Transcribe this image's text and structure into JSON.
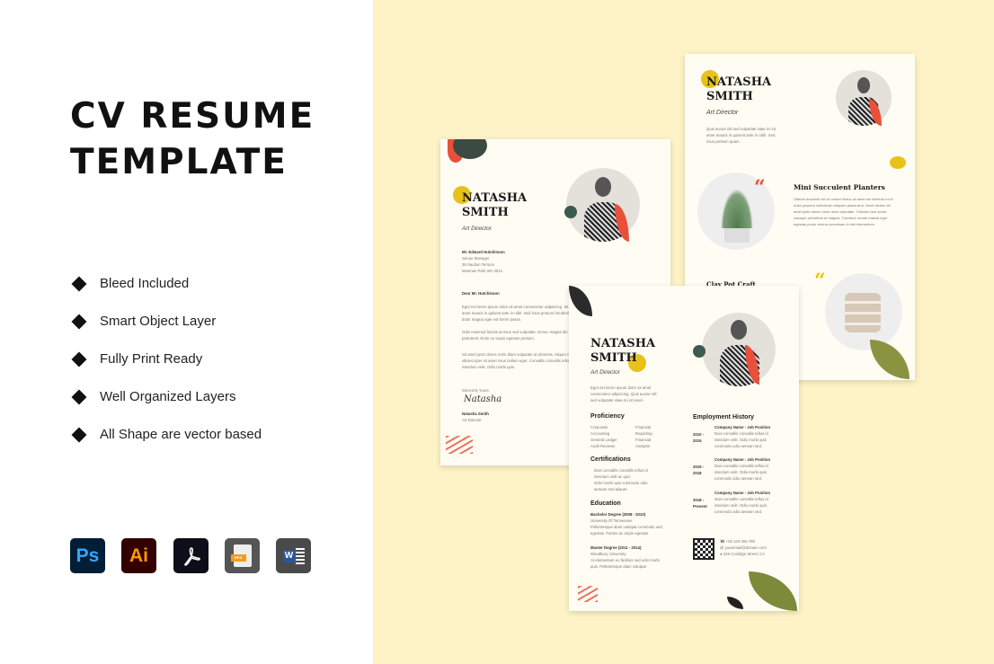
{
  "heading": {
    "line1": "CV RESUME",
    "line2": "TEMPLATE"
  },
  "features": [
    "Bleed Included",
    "Smart Object Layer",
    "Fully Print Ready",
    "Well Organized Layers",
    "All Shape are vector based"
  ],
  "software_icons": [
    {
      "name": "photoshop",
      "label": "Ps",
      "bg": "#001e36",
      "fg": "#31a8ff"
    },
    {
      "name": "illustrator",
      "label": "Ai",
      "bg": "#330000",
      "fg": "#ff9a00"
    },
    {
      "name": "acrobat",
      "label": "⅂",
      "bg": "#0e0e1a",
      "fg": "#ffffff"
    },
    {
      "name": "eps",
      "label": "EPS",
      "bg": "#555555",
      "fg": "#f59b23"
    },
    {
      "name": "word",
      "label": "W",
      "bg": "#4a4a4a",
      "fg": "#2b5797"
    }
  ],
  "colors": {
    "background": "#fdf3c6",
    "accent_yellow": "#e8c21a",
    "accent_red": "#e8503a",
    "leaf_green": "#7d8a3a"
  },
  "cover_letter": {
    "first": "NATASHA",
    "last": "SMITH",
    "role": "Art Director",
    "recipient": [
      "Mr. Edward Hutchinson",
      "Senior Manager",
      "39 Saulton Terrace",
      "Mosman Park WA 3012"
    ],
    "salutation": "Dear Mr. Hutchinson",
    "paragraphs": [
      "Eget est lorem ipsum dolor sit amet consectetur adipiscing. Sit amet mauris in quisest ante in nibh. Sed risus pretium hendrerit dolor magna eget est lorem ipsum.",
      "Odio euismod lacinia at risus sed vulputate. Donec magna dis parturient. Enim eu turpis egestas pretium.",
      "Sit amet justo donec enim diam vulputate ut pharetra. Aliquet nec ullamcorper sit amet risus nullam eget. Convallis convallis tellus interdum velit. Odio morbi quis."
    ],
    "closing": "Sincerely Yours,",
    "signature": "Natasha",
    "sign_name": "Natasha Smith",
    "sign_role": "Art Director"
  },
  "portfolio": {
    "first": "NATASHA",
    "last": "SMITH",
    "role": "Art Director",
    "intro": "Quis auctor elit sed vulputate vitae mi sit amet mauris in quisest ante in nibh. Sed risus pretium quam",
    "project_title": "Mini Succulent Planters",
    "project_text": "Ultrices tincidunt dui ut ornare lectus sit amet est eleifend mi in nulla posuere sollicitudin aliquam placerat in. Amet dictum sit amet justo donec enim diam vulputate. Gravida cum sociis natoque penatibus et magnis. Tincidunt ornare massa eget egestas purus viverra accumsan in nisl elementum.",
    "second_title": "Clay Pot Craft"
  },
  "resume": {
    "first": "NATASHA",
    "last": "SMITH",
    "role": "Art Director",
    "intro": "Eget est lorem ipsum dolor sit amet consectetur adipiscing. Quis auctor elit sed vulputate vitae mi sit amet.",
    "proficiency_title": "Proficiency",
    "proficiency": [
      "Corporate",
      "Accounting",
      "General Ledger",
      "Audit Reviews",
      "Financial",
      "Reporting",
      "Financial",
      "Analysis"
    ],
    "certifications_title": "Certifications",
    "certifications": [
      "Duis convallis convallis tellus id",
      "interdum velit ac quis",
      "Odio morbi quis commodo odio",
      "aenean sed aliquet."
    ],
    "education_title": "Education",
    "education": [
      {
        "degree": "Bachelor Degree (2008 - 2010)",
        "school": "University Of Tennessee",
        "text": "Pellentesque diam volutpat commodo sed egestas. Fames ac turpis egestas"
      },
      {
        "degree": "Master Degree (2011 - 2014)",
        "school": "Woodbury University",
        "text": "At elementum eu facilisis sed odio morbi quis. Pellentesque diam volutpat"
      }
    ],
    "employment_title": "Employment History",
    "jobs": [
      {
        "years": "2010 - 2015",
        "position": "Company Name - Job Position",
        "text": "Duis convallis convallis tellus id interdum velit. Odio morbi quis commodo odio aenean sed."
      },
      {
        "years": "2015 - 2018",
        "position": "Company Name - Job Position",
        "text": "Duis convallis convallis tellus id interdum velit. Odio morbi quis commodo odio aenean sed."
      },
      {
        "years": "2018 - Present",
        "position": "Company Name - Job Position",
        "text": "Duis convallis convallis tellus id interdum velit. Odio morbi quis commodo odio aenean sed."
      }
    ],
    "phone": "+00 123 456 789",
    "email": "youremail@domain.com",
    "address": "246 Coolidge Street, CA"
  }
}
